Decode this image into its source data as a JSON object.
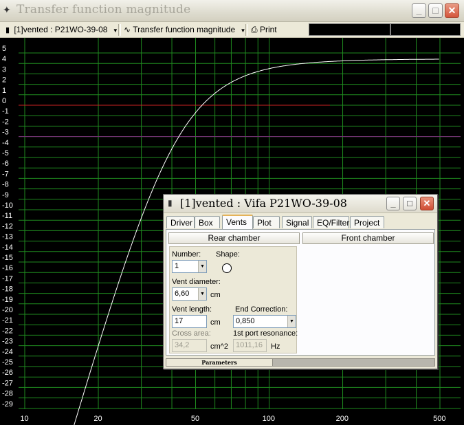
{
  "window": {
    "title": "Transfer function magnitude"
  },
  "toolbar": {
    "project_label": "[1]vented : P21WO-39-08",
    "view_label": "Transfer function magnitude",
    "print_label": "Print"
  },
  "plot": {
    "y_ticks": [
      "5",
      "4",
      "3",
      "2",
      "1",
      "0",
      "-1",
      "-2",
      "-3",
      "-4",
      "-5",
      "-6",
      "-7",
      "-8",
      "-9",
      "-10",
      "-11",
      "-12",
      "-13",
      "-14",
      "-15",
      "-16",
      "-17",
      "-18",
      "-19",
      "-20",
      "-21",
      "-22",
      "-23",
      "-24",
      "-25",
      "-26",
      "-27",
      "-28",
      "-29"
    ],
    "x_ticks": [
      "10",
      "20",
      "50",
      "100",
      "200",
      "500"
    ],
    "colors": {
      "background": "#000000",
      "grid": "#1f8a1f",
      "curve": "#ffffff",
      "ref_red": "#cc2222",
      "ref_purple": "#7a2a7a"
    }
  },
  "dialog": {
    "title": "[1]vented : Vifa P21WO-39-08",
    "tabs": [
      "Driver",
      "Box",
      "Vents",
      "Plot",
      "Signal",
      "EQ/Filter",
      "Project"
    ],
    "active_tab": "Vents",
    "rear_chamber_label": "Rear chamber",
    "front_chamber_label": "Front chamber",
    "number_label": "Number:",
    "number_value": "1",
    "shape_label": "Shape:",
    "vent_diameter_label": "Vent diameter:",
    "vent_diameter_value": "6,60",
    "vent_diameter_unit": "cm",
    "vent_length_label": "Vent length:",
    "vent_length_value": "17",
    "vent_length_unit": "cm",
    "end_correction_label": "End Correction:",
    "end_correction_value": "0,850",
    "cross_area_label": "Cross area:",
    "cross_area_value": "34,2",
    "cross_area_unit": "cm^2",
    "port_resonance_label": "1st port resonance:",
    "port_resonance_value": "1011,16",
    "port_resonance_unit": "Hz",
    "parameters_tab": "Parameters"
  }
}
